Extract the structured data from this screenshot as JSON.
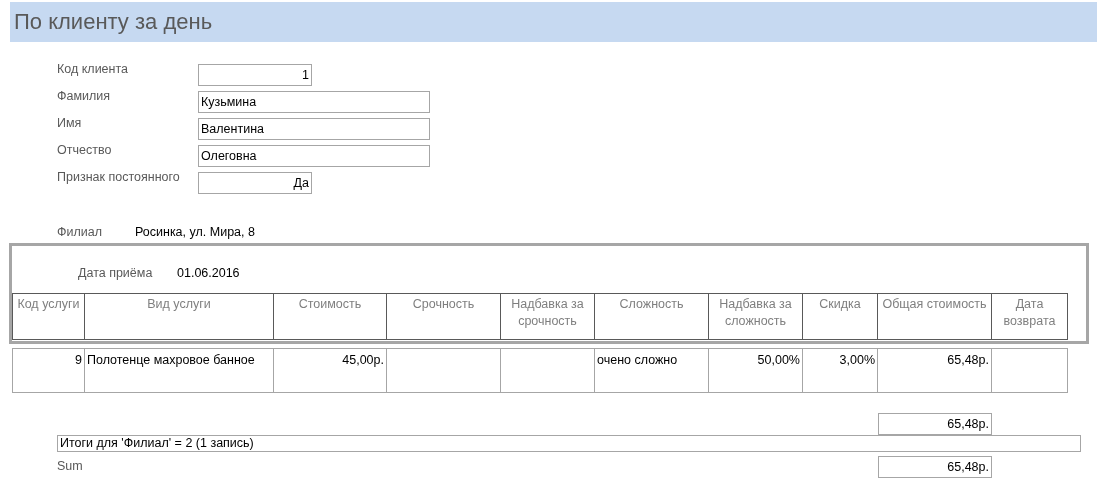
{
  "title": "По клиенту за день",
  "client_fields": [
    {
      "label": "Код клиента",
      "value": "1",
      "kind": "number"
    },
    {
      "label": "Фамилия",
      "value": "Кузьмина",
      "kind": "text"
    },
    {
      "label": "Имя",
      "value": "Валентина",
      "kind": "text"
    },
    {
      "label": "Отчество",
      "value": "Олеговна",
      "kind": "text"
    },
    {
      "label": "Признак постоянного",
      "value": "Да",
      "kind": "number"
    }
  ],
  "branch": {
    "label": "Филиал",
    "value": "Росинка, ул. Мира, 8"
  },
  "group": {
    "label": "Дата приёма",
    "value": "01.06.2016"
  },
  "table": {
    "columns": [
      "Код услуги",
      "Вид услуги",
      "Стоимость",
      "Срочность",
      "Надбавка за срочность",
      "Сложность",
      "Надбавка за сложность",
      "Скидка",
      "Общая стоимость",
      "Дата возврата"
    ],
    "rows": [
      [
        "9",
        "Полотенце  махровое банное",
        "45,00р.",
        "",
        "",
        "очено сложно",
        "50,00%",
        "3,00%",
        "65,48р.",
        ""
      ]
    ]
  },
  "group_total": "65,48р.",
  "summary": "Итоги для 'Филиал' =  2 (1 запись)",
  "sum": {
    "label": "Sum",
    "value": "65,48р."
  }
}
